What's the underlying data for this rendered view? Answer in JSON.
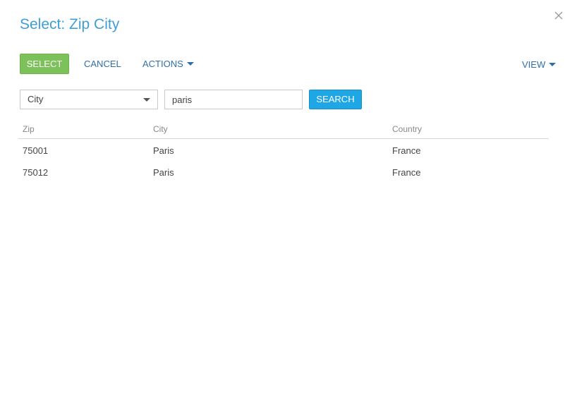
{
  "dialog": {
    "title": "Select: Zip City"
  },
  "toolbar": {
    "select_label": "SELECT",
    "cancel_label": "CANCEL",
    "actions_label": "ACTIONS",
    "view_label": "VIEW"
  },
  "filter": {
    "column_selected": "City",
    "search_value": "paris",
    "search_label": "SEARCH"
  },
  "grid": {
    "columns": [
      "Zip",
      "City",
      "Country"
    ],
    "rows": [
      {
        "zip": "75001",
        "city": "Paris",
        "country": "France"
      },
      {
        "zip": "75012",
        "city": "Paris",
        "country": "France"
      }
    ]
  },
  "colors": {
    "title": "#3f9fd4",
    "select_button": "#7cc15a",
    "search_button": "#1ea7e4",
    "link": "#2f6fa8"
  },
  "icons": {
    "close": "close-icon",
    "caret": "chevron-down-icon"
  }
}
